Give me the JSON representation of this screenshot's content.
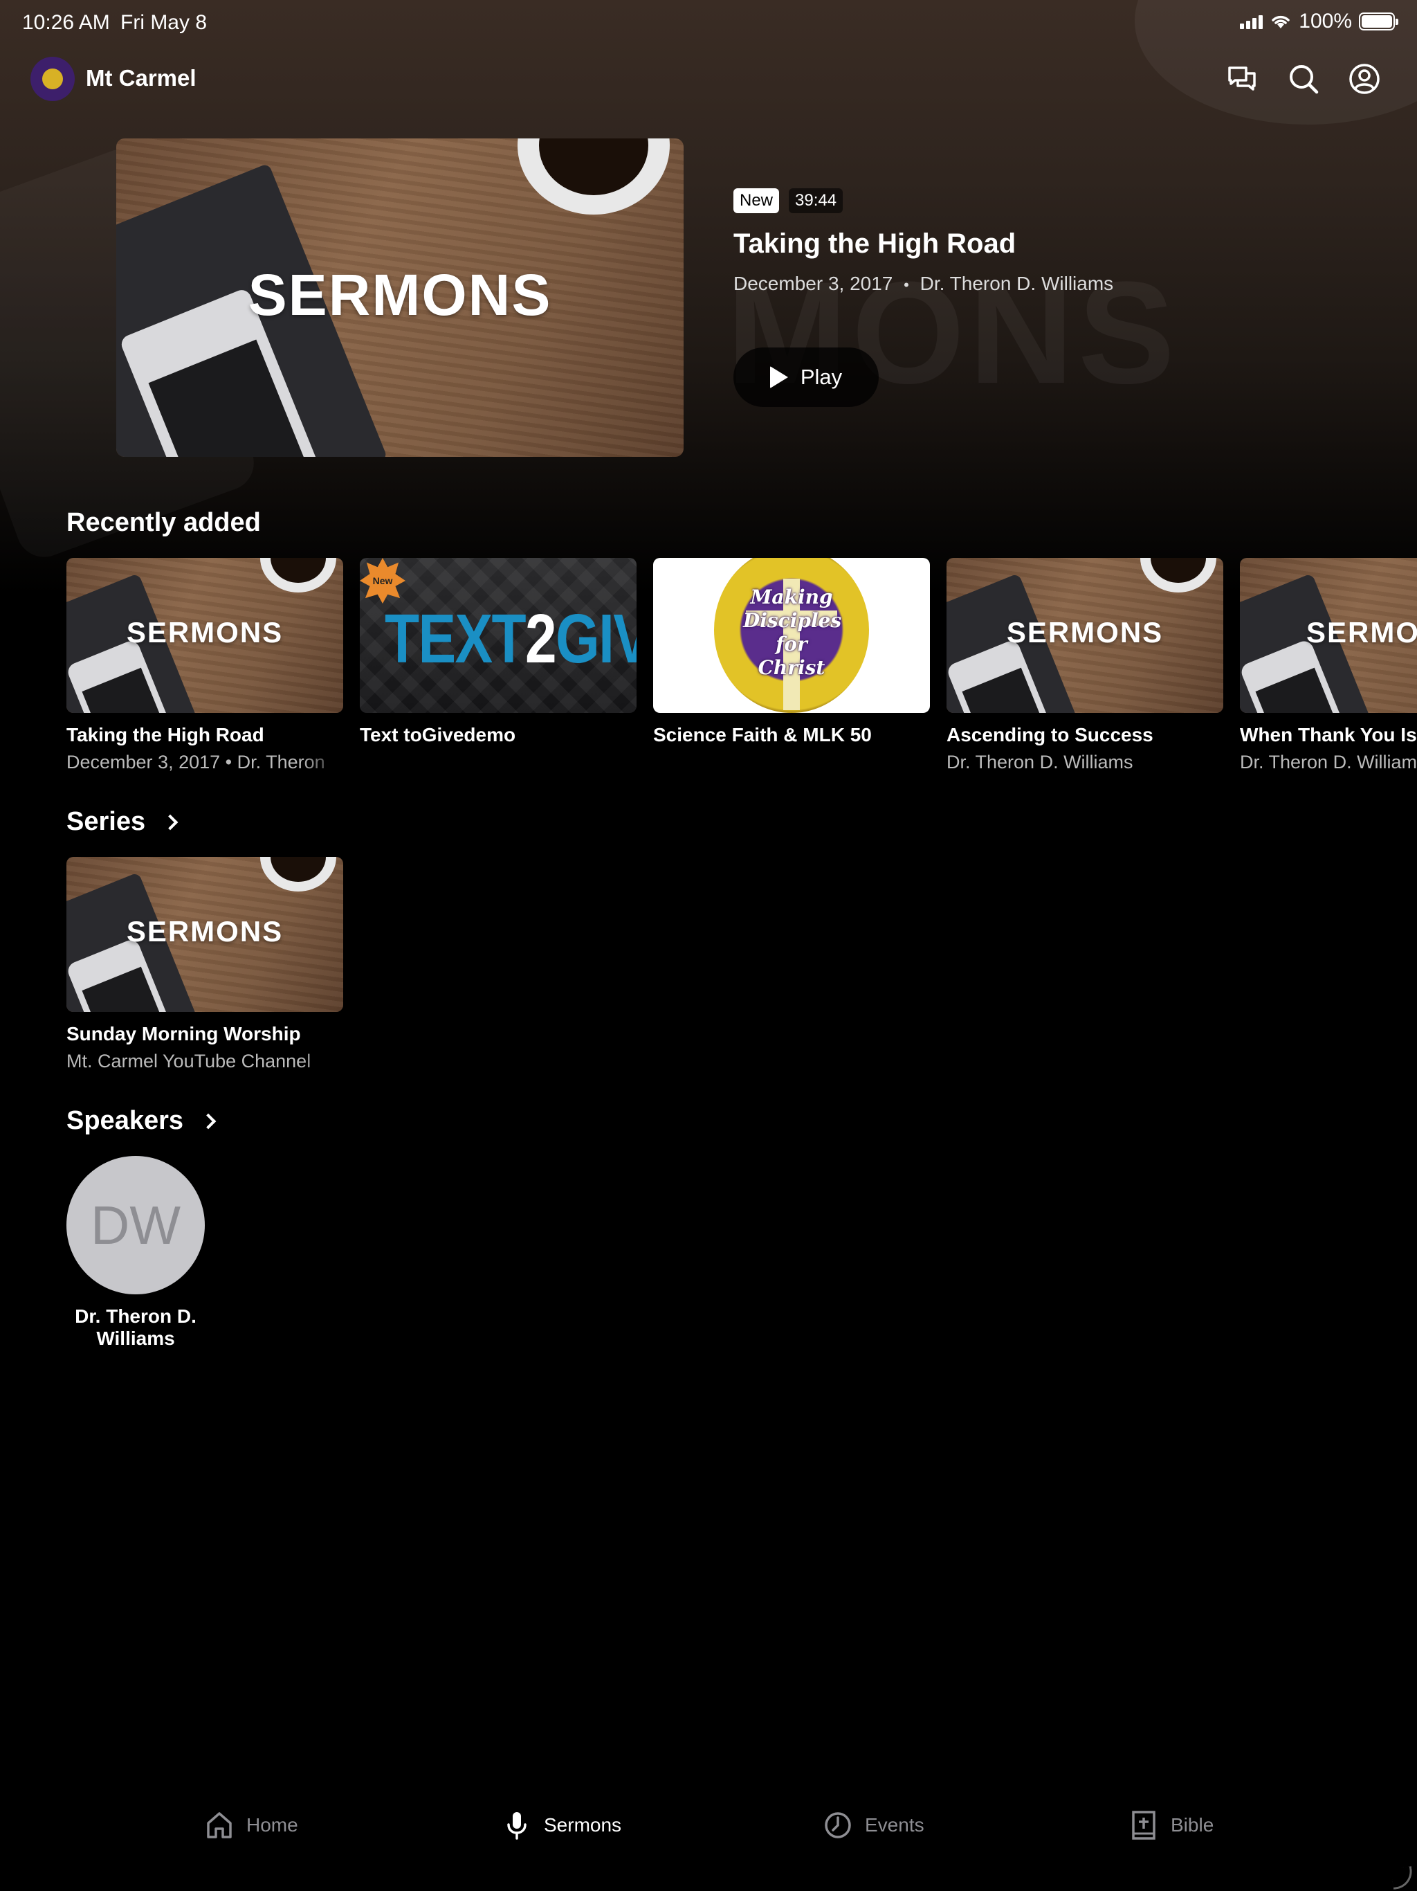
{
  "status_bar": {
    "time": "10:26 AM",
    "date": "Fri May 8",
    "battery": "100%",
    "battery_level": 1.0
  },
  "header": {
    "title": "Mt Carmel",
    "icons": [
      "messages-icon",
      "search-icon",
      "account-icon"
    ]
  },
  "hero": {
    "thumbnail_label": "SERMONS",
    "badge_new": "New",
    "duration": "39:44",
    "title": "Taking the High Road",
    "date": "December 3, 2017",
    "separator": "•",
    "speaker": "Dr. Theron D. Williams",
    "play_label": "Play"
  },
  "recently_added": {
    "heading": "Recently added",
    "items": [
      {
        "thumb": "sermons",
        "thumb_label": "SERMONS",
        "title": "Taking the High Road",
        "subtitle": "December 3, 2017 • Dr. Theron"
      },
      {
        "thumb": "text2give",
        "thumb_word_a": "TEXT",
        "thumb_word_b": "2",
        "thumb_word_c": "GIVE",
        "thumb_badge": "New",
        "title": "Text toGivedemo",
        "subtitle": ""
      },
      {
        "thumb": "mlk",
        "thumb_text": "Making Disciples for Christ",
        "title": "Science Faith & MLK 50",
        "subtitle": ""
      },
      {
        "thumb": "sermons",
        "thumb_label": "SERMONS",
        "title": "Ascending to Success",
        "subtitle": "Dr. Theron D. Williams"
      },
      {
        "thumb": "sermons",
        "thumb_label": "SERMO",
        "title": "When Thank You Is",
        "subtitle": "Dr. Theron D. William"
      }
    ]
  },
  "series": {
    "heading": "Series",
    "items": [
      {
        "thumb_label": "SERMONS",
        "title": "Sunday Morning Worship",
        "subtitle": "Mt. Carmel YouTube Channel"
      }
    ]
  },
  "speakers": {
    "heading": "Speakers",
    "items": [
      {
        "initials": "DW",
        "name": "Dr. Theron D. Williams"
      }
    ]
  },
  "tabbar": {
    "tabs": [
      {
        "label": "Home",
        "icon": "home-icon",
        "active": false
      },
      {
        "label": "Sermons",
        "icon": "microphone-icon",
        "active": true
      },
      {
        "label": "Events",
        "icon": "clock-icon",
        "active": false
      },
      {
        "label": "Bible",
        "icon": "bible-icon",
        "active": false
      }
    ]
  },
  "colors": {
    "background": "#000000",
    "text2give_blue": "#1a8fc4",
    "logo_purple": "#3d1f6b",
    "logo_gold": "#d8b125"
  }
}
